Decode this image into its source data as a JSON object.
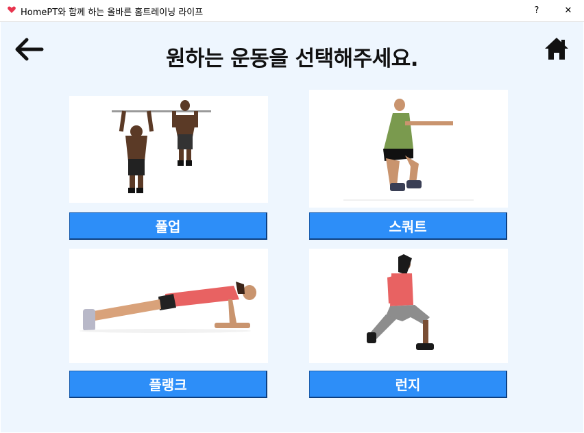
{
  "window": {
    "title": "HomePT와 함께 하는 올바른 홈트레이닝 라이프",
    "help_label": "?",
    "close_label": "✕"
  },
  "header": {
    "title": "원하는 운동을 선택해주세요."
  },
  "exercises": [
    {
      "label": "풀업"
    },
    {
      "label": "스쿼트"
    },
    {
      "label": "플랭크"
    },
    {
      "label": "런지"
    }
  ],
  "colors": {
    "accent": "#2d8ef8",
    "background": "#eef6fe",
    "heart": "#e8344e"
  }
}
